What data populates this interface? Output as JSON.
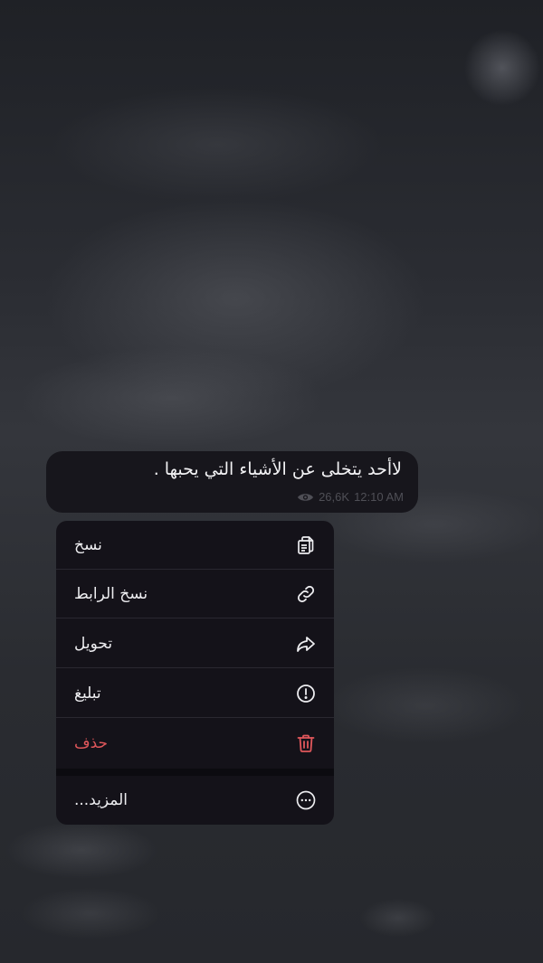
{
  "message": {
    "text": "لاأحد يتخلى عن الأشياء التي يحبها .",
    "views": "26,6K",
    "time": "12:10 AM"
  },
  "menu": {
    "items": [
      {
        "label": "نسخ",
        "icon": "copy-icon"
      },
      {
        "label": "نسخ الرابط",
        "icon": "link-icon"
      },
      {
        "label": "تحويل",
        "icon": "forward-icon"
      },
      {
        "label": "تبليغ",
        "icon": "report-icon"
      },
      {
        "label": "حذف",
        "icon": "trash-icon",
        "color": "#e0575b"
      },
      {
        "label": "المزيد...",
        "icon": "more-icon"
      }
    ]
  },
  "colors": {
    "bubble": "#17161c",
    "menu_bg": "#141219",
    "danger": "#e0575b",
    "meta_text": "#4f4f56"
  }
}
